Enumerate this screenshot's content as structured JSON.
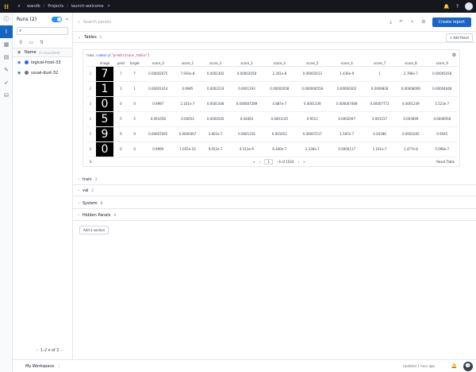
{
  "topbar": {
    "breadcrumbs": [
      "wandb",
      "Projects",
      "launch-welcome"
    ],
    "separator": "/",
    "icons": [
      "search-icon",
      "bell-icon",
      "help-icon",
      "avatar"
    ]
  },
  "rail": {
    "items": [
      "info-icon",
      "chart-icon",
      "table-icon",
      "document-icon",
      "brush-icon",
      "rocket-icon",
      "database-icon"
    ]
  },
  "runs": {
    "title": "Runs (2)",
    "collapse_icon": "«",
    "search_placeholder": "",
    "column_name": "Name",
    "column_sub": "(2 visualized)",
    "rows": [
      {
        "name": "logical-frost-33",
        "color": "#2563eb"
      },
      {
        "name": "usual-dust-32",
        "color": "#6b7280"
      }
    ],
    "pager": "1-2 ▾ of 2"
  },
  "main": {
    "search_placeholder": "Search panels",
    "create_report": "Create report"
  },
  "tables_section": {
    "title": "Tables",
    "count": "1",
    "add_panel": "+ Add Panel",
    "code": {
      "prefix": "runs.",
      "func": "summary",
      "open": "[",
      "key": "\"predictions_table\"",
      "close": "]"
    },
    "columns": [
      "",
      "image",
      "pred",
      "target",
      "score_0",
      "score_1",
      "score_2",
      "score_3",
      "score_4",
      "score_5",
      "score_6",
      "score_7",
      "score_8",
      "score_9"
    ],
    "rows": [
      {
        "idx": "1",
        "digit": "7",
        "pred": "7",
        "target": "7",
        "scores": [
          "0.00002675",
          "7.930e-8",
          "0.0001402",
          "0.00002058",
          "2.341e-8",
          "0.00002013",
          "1.436e-9",
          "1",
          "2.786e-7",
          "0.00005418"
        ]
      },
      {
        "idx": "2",
        "digit": "1",
        "pred": "1",
        "target": "1",
        "scores": [
          "0.00001414",
          "0.9985",
          "0.0002219",
          "0.0001193",
          "0.00002058",
          "0.000006558",
          "0.00006302",
          "0.0009828",
          "0.00008006",
          "0.00004648"
        ]
      },
      {
        "idx": "3",
        "digit": "0",
        "pred": "0",
        "target": "0",
        "scores": [
          "0.9997",
          "2.161e-7",
          "0.0001448",
          "0.000007289",
          "4.887e-7",
          "0.0001339",
          "0.000007469",
          "0.00007772",
          "0.0001249",
          "5.523e-7"
        ]
      },
      {
        "idx": "4",
        "digit": "5",
        "pred": "5",
        "target": "5",
        "scores": [
          "0.001058",
          "0.00052",
          "0.0004545",
          "0.04063",
          "0.0001145",
          "0.9511",
          "0.0002097",
          "0.001157",
          "0.003699",
          "0.0006958"
        ]
      },
      {
        "idx": "5",
        "digit": "9",
        "pred": "9",
        "target": "9",
        "scores": [
          "0.00007065",
          "0.0000467",
          "3.601e-7",
          "0.0001156",
          "0.001652",
          "0.00007217",
          "1.587e-7",
          "0.04286",
          "0.0001005",
          "0.9545"
        ]
      },
      {
        "idx": "6",
        "digit": "0",
        "pred": "0",
        "target": "0",
        "scores": [
          "0.9999",
          "1.655e-10",
          "9.052e-7",
          "4.513e-9",
          "6.440e-7",
          "2.236e-7",
          "0.0000117",
          "1.161e-7",
          "1.477e-8",
          "5.098e-7"
        ]
      }
    ],
    "footer": {
      "count": "6",
      "first": "«",
      "prev": "‹",
      "page": "1",
      "of_text": "- 6 of 1024",
      "next": "›",
      "last": "»",
      "reset": "Reset Table"
    }
  },
  "sections": [
    {
      "title": "train",
      "count": "3"
    },
    {
      "title": "val",
      "count": "2"
    },
    {
      "title": "System",
      "count": "8"
    },
    {
      "title": "Hidden Panels",
      "count": "0"
    }
  ],
  "add_section": "Add a section",
  "bottombar": {
    "workspace": "My Workspace",
    "updated": "Updated 1 hour ago",
    "more": "⋮"
  },
  "colors": {
    "accent": "#1765c4",
    "topbar": "#15171c",
    "rail_active": "#1665c0"
  }
}
